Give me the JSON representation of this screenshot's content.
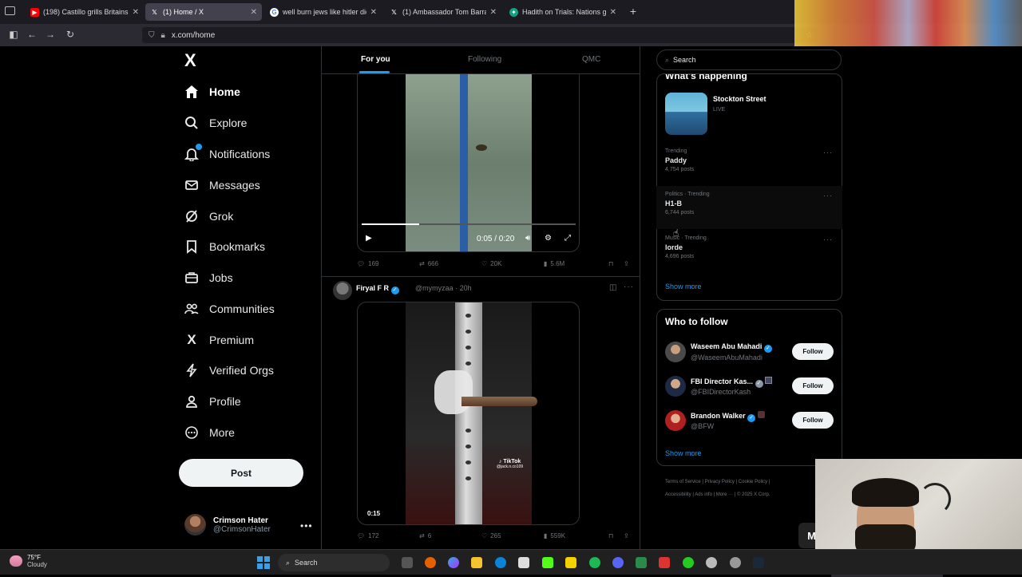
{
  "browser": {
    "tabs": [
      {
        "title": "(198) Castillo grills Britains bigg",
        "icon_color": "#ff0000",
        "active": false
      },
      {
        "title": "(1) Home / X",
        "icon_color": "#ffffff",
        "active": true
      },
      {
        "title": "well burn jews like hitler did say",
        "icon_color": "#4285f4",
        "active": false
      },
      {
        "title": "(1) Ambassador Tom Barrack on",
        "icon_color": "#ffffff",
        "active": false
      },
      {
        "title": "Hadith on Trials: Nations gathe",
        "icon_color": "#10a37f",
        "active": false
      }
    ],
    "url": "x.com/home",
    "new_tab": "+"
  },
  "sidebar": {
    "logo": "X",
    "items": [
      {
        "label": "Home",
        "icon": "home-icon",
        "active": true
      },
      {
        "label": "Explore",
        "icon": "search-icon"
      },
      {
        "label": "Notifications",
        "icon": "bell-icon",
        "badge": true
      },
      {
        "label": "Messages",
        "icon": "mail-icon"
      },
      {
        "label": "Grok",
        "icon": "grok-icon"
      },
      {
        "label": "Bookmarks",
        "icon": "bookmark-icon"
      },
      {
        "label": "Jobs",
        "icon": "briefcase-icon"
      },
      {
        "label": "Communities",
        "icon": "people-icon"
      },
      {
        "label": "Premium",
        "icon": "x-premium-icon"
      },
      {
        "label": "Verified Orgs",
        "icon": "lightning-icon"
      },
      {
        "label": "Profile",
        "icon": "person-icon"
      },
      {
        "label": "More",
        "icon": "more-circle-icon"
      }
    ],
    "post_label": "Post",
    "account": {
      "name": "Crimson Hater",
      "handle": "@CrimsonHater",
      "more": "•••"
    }
  },
  "timeline": {
    "tabs": [
      "For you",
      "Following",
      "QMC"
    ],
    "post1": {
      "video_time": "0:05 / 0:20",
      "progress": 0.27,
      "replies": "169",
      "reposts": "666",
      "likes": "20K",
      "views": "5.6M"
    },
    "post2": {
      "name": "Firyal F R",
      "handle": "@mymyzaa · 20h",
      "duration": "0:15",
      "watermark": "TikTok",
      "watermark_handle": "@jack.n.co109",
      "replies": "172",
      "reposts": "6",
      "likes": "265",
      "views": "559K"
    }
  },
  "right": {
    "search_placeholder": "Search",
    "whats_happening": {
      "title": "What's happening",
      "live": {
        "title": "Stockton Street",
        "status": "LIVE"
      },
      "trends": [
        {
          "context": "Trending",
          "topic": "Paddy",
          "count": "4,754 posts"
        },
        {
          "context": "Politics · Trending",
          "topic": "H1-B",
          "count": "6,744 posts"
        },
        {
          "context": "Music · Trending",
          "topic": "lorde",
          "count": "4,696 posts"
        }
      ],
      "show_more": "Show more"
    },
    "who_to_follow": {
      "title": "Who to follow",
      "users": [
        {
          "name": "Waseem Abu Mahadi",
          "handle": "@WaseemAbuMahadi",
          "button": "Follow"
        },
        {
          "name": "FBI Director Kas...",
          "handle": "@FBIDirectorKash",
          "button": "Follow"
        },
        {
          "name": "Brandon Walker",
          "handle": "@BFW",
          "button": "Follow"
        }
      ],
      "show_more": "Show more"
    },
    "footer": {
      "row1": "Terms of Service  |  Privacy Policy  |  Cookie Policy  |",
      "row2": "Accessibility  |  Ads info  |  More ···  |  © 2025 X Corp."
    }
  },
  "overlay": {
    "m_label": "M"
  },
  "taskbar": {
    "temp": "75°F",
    "condition": "Cloudy",
    "search_label": "Search"
  }
}
